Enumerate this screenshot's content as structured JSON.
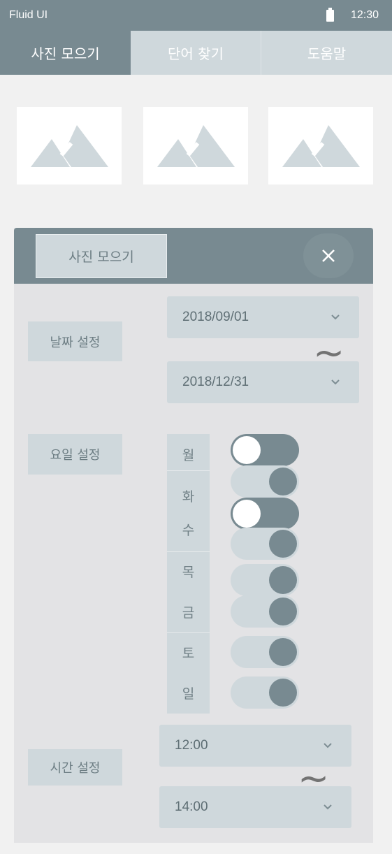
{
  "status_bar": {
    "app_title": "Fluid UI",
    "time": "12:30"
  },
  "tabs": [
    {
      "label": "사진 모으기",
      "active": true
    },
    {
      "label": "단어 찾기",
      "active": false
    },
    {
      "label": "도움말",
      "active": false
    }
  ],
  "thumbnails": [
    {
      "icon": "image-placeholder-icon"
    },
    {
      "icon": "image-placeholder-icon"
    },
    {
      "icon": "image-placeholder-icon"
    }
  ],
  "panel": {
    "title": "사진 모으기",
    "close_icon": "close-icon",
    "date_label": "날짜 설정",
    "date_from": "2018/09/01",
    "date_separator": "~",
    "date_to": "2018/12/31",
    "weekday_label": "요일 설정",
    "weekdays": [
      {
        "label": "월",
        "enabled": true
      },
      {
        "label": "화",
        "enabled": false
      },
      {
        "label": "수",
        "enabled": true
      },
      {
        "label": "목",
        "enabled": false
      },
      {
        "label": "금",
        "enabled": false
      },
      {
        "label": "토",
        "enabled": false
      },
      {
        "label": "일",
        "enabled": false
      }
    ],
    "time_label": "시간 설정",
    "time_from": "12:00",
    "time_separator": "~",
    "time_to": "14:00"
  },
  "colors": {
    "primary": "#788a91",
    "light": "#cfd8dc",
    "background": "#f1f1f1",
    "panel": "#e3e3e5"
  }
}
